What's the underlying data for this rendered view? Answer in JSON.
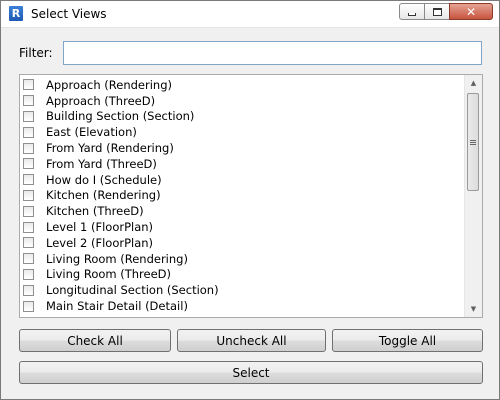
{
  "window": {
    "title": "Select Views",
    "app_icon_letter": "R",
    "controls": {
      "minimize": "minimize-icon",
      "maximize": "maximize-icon",
      "close": "close-icon",
      "close_glyph": "✕"
    }
  },
  "filter": {
    "label": "Filter:",
    "value": "",
    "placeholder": ""
  },
  "views": [
    {
      "label": "Approach (Rendering)",
      "checked": false
    },
    {
      "label": "Approach (ThreeD)",
      "checked": false
    },
    {
      "label": "Building Section (Section)",
      "checked": false
    },
    {
      "label": "East (Elevation)",
      "checked": false
    },
    {
      "label": "From Yard (Rendering)",
      "checked": false
    },
    {
      "label": "From Yard (ThreeD)",
      "checked": false
    },
    {
      "label": "How do I (Schedule)",
      "checked": false
    },
    {
      "label": "Kitchen (Rendering)",
      "checked": false
    },
    {
      "label": "Kitchen (ThreeD)",
      "checked": false
    },
    {
      "label": "Level 1 (FloorPlan)",
      "checked": false
    },
    {
      "label": "Level 2 (FloorPlan)",
      "checked": false
    },
    {
      "label": "Living Room (Rendering)",
      "checked": false
    },
    {
      "label": "Living Room (ThreeD)",
      "checked": false
    },
    {
      "label": "Longitudinal Section (Section)",
      "checked": false
    },
    {
      "label": "Main Stair Detail (Detail)",
      "checked": false
    }
  ],
  "scrollbar": {
    "up_glyph": "▲",
    "down_glyph": "▼"
  },
  "buttons": {
    "check_all": "Check All",
    "uncheck_all": "Uncheck All",
    "toggle_all": "Toggle All",
    "select": "Select"
  }
}
